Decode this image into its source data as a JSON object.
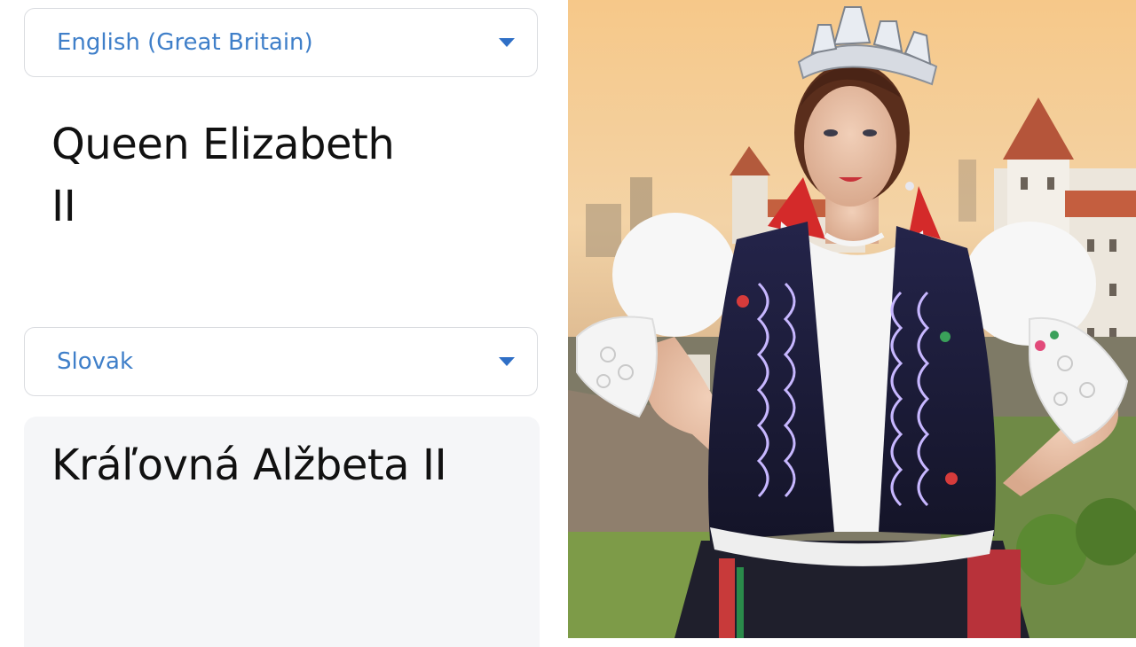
{
  "translator": {
    "source": {
      "language": "English (Great Britain)",
      "text": "Queen Elizabeth\nII"
    },
    "target": {
      "language": "Slovak",
      "text": "Kráľovná Alžbeta II"
    }
  },
  "icons": {
    "dropdown": "chevron-down-icon"
  },
  "colors": {
    "accent": "#3f7fc9",
    "caret": "#2f6fc6",
    "translation_bg": "#f5f6f8",
    "vest": "#2a2a5c",
    "sky": "#f2c98a"
  }
}
